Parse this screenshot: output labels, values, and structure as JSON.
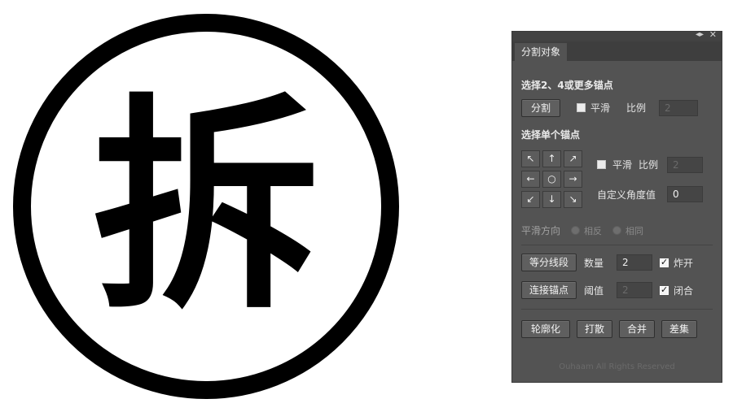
{
  "artwork": {
    "glyph": "拆"
  },
  "panel": {
    "tab_label": "分割对象",
    "section1_title": "选择2、4或更多锚点",
    "split_button": "分割",
    "smooth_label_1": "平滑",
    "ratio_label_1": "比例",
    "ratio_value_1": "2",
    "section2_title": "选择单个锚点",
    "arrows": [
      "↖",
      "↑",
      "↗",
      "←",
      "○",
      "→",
      "↙",
      "↓",
      "↘"
    ],
    "smooth_label_2": "平滑",
    "ratio_label_2": "比例",
    "ratio_value_2": "2",
    "custom_angle_label": "自定义角度值",
    "custom_angle_value": "0",
    "smooth_direction_label": "平滑方向",
    "radio_opposite": "相反",
    "radio_same": "相同",
    "equal_segments_button": "等分线段",
    "count_label": "数量",
    "count_value": "2",
    "explode_label": "炸开",
    "explode_checked": true,
    "connect_anchors_button": "连接锚点",
    "threshold_label": "阈值",
    "threshold_value": "2",
    "close_label": "闭合",
    "close_checked": true,
    "outline_button": "轮廓化",
    "break_button": "打散",
    "merge_button": "合并",
    "difference_button": "差集",
    "footer": "Ouhaam All Rights Reserved"
  }
}
